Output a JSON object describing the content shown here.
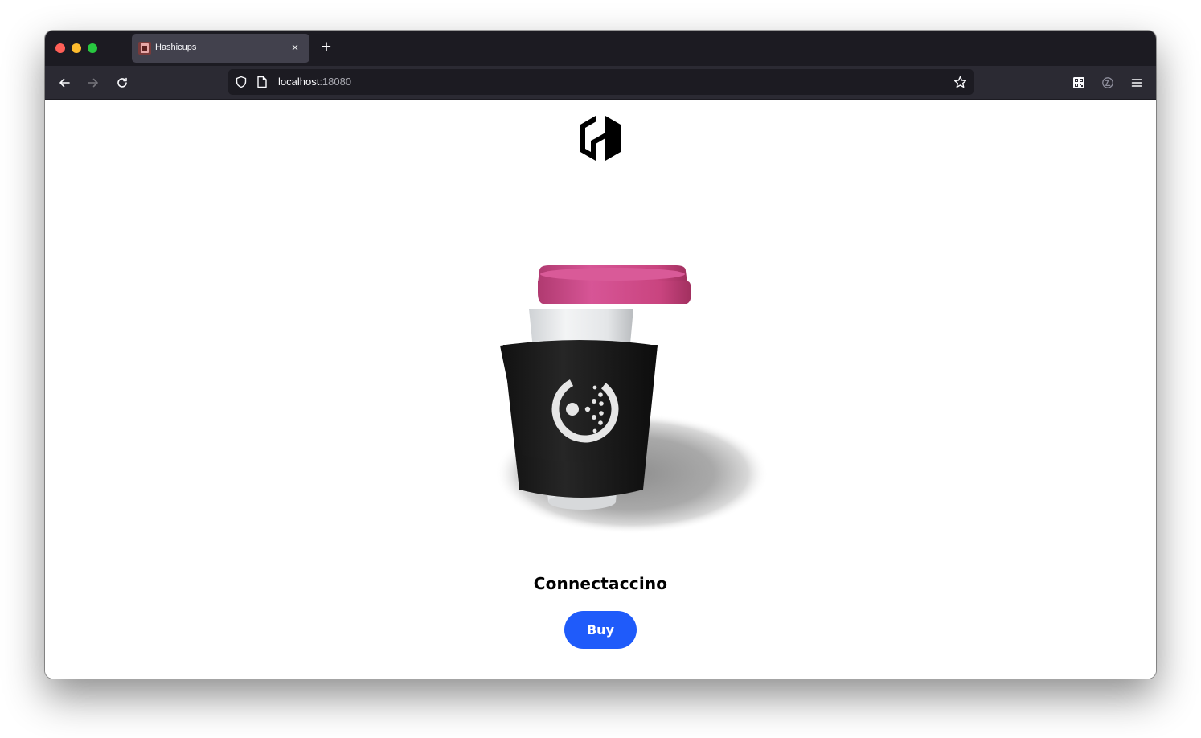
{
  "browser": {
    "tab": {
      "title": "Hashicups",
      "close_glyph": "×"
    },
    "new_tab_glyph": "+",
    "url": {
      "host": "localhost",
      "port": ":18080"
    },
    "icons": {
      "back": "back-arrow-icon",
      "forward": "forward-arrow-icon",
      "reload": "reload-icon",
      "shield": "shield-icon",
      "page": "page-icon",
      "bookmark": "star-icon",
      "qr": "qr-code-icon",
      "extension": "extension-icon",
      "menu": "hamburger-menu-icon"
    }
  },
  "page": {
    "logo": "hashicorp-logo-icon",
    "product": {
      "name": "Connectaccino",
      "image": "coffee-cup-image"
    },
    "buy_label": "Buy"
  },
  "colors": {
    "buy_button": "#1f5bfa",
    "cup_lid": "#c9447f",
    "cup_sleeve": "#1b1b1b",
    "cup_body": "#e8eaec",
    "tab_bar": "#1c1b22",
    "nav_bar": "#2b2a33"
  }
}
